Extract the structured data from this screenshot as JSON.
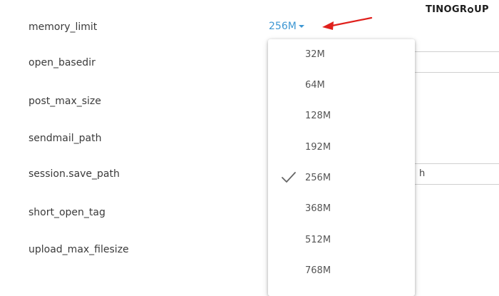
{
  "brand": {
    "prefix": "TINO",
    "suffix": "GR",
    "tail": "UP"
  },
  "settings": [
    {
      "label": "memory_limit"
    },
    {
      "label": "open_basedir"
    },
    {
      "label": "post_max_size"
    },
    {
      "label": "sendmail_path"
    },
    {
      "label": "session.save_path",
      "field_value": "h"
    },
    {
      "label": "short_open_tag"
    },
    {
      "label": "upload_max_filesize"
    }
  ],
  "memory_limit": {
    "current_value": "256M",
    "options": [
      {
        "label": "32M",
        "selected": false
      },
      {
        "label": "64M",
        "selected": false
      },
      {
        "label": "128M",
        "selected": false
      },
      {
        "label": "192M",
        "selected": false
      },
      {
        "label": "256M",
        "selected": true
      },
      {
        "label": "368M",
        "selected": false
      },
      {
        "label": "512M",
        "selected": false
      },
      {
        "label": "768M",
        "selected": false
      }
    ]
  },
  "colors": {
    "link": "#3d97d3",
    "annotation_arrow": "#e0201c",
    "text": "#3a3a3a"
  }
}
